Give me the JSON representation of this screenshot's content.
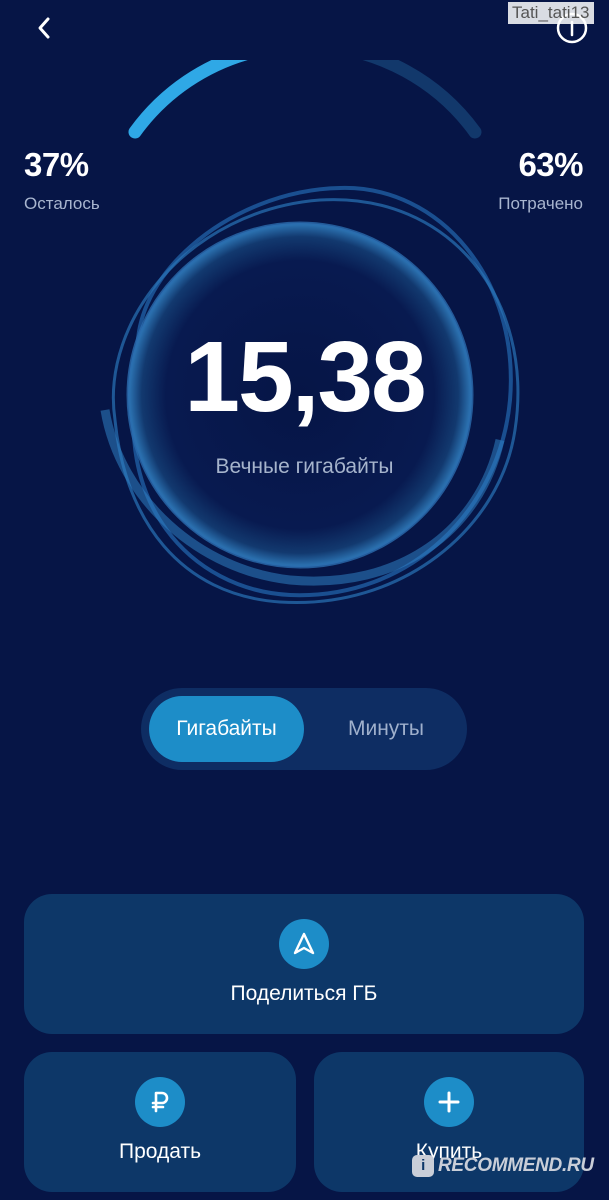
{
  "header": {
    "back_icon": "chevron-left-icon",
    "info_icon": "info-icon",
    "watermark_user": "Tati_tati13"
  },
  "usage": {
    "remaining_percent_label": "37%",
    "remaining_label": "Осталось",
    "spent_percent_label": "63%",
    "spent_label": "Потрачено",
    "remaining_fraction": 0.37
  },
  "balance": {
    "value": "15,38",
    "caption": "Вечные гигабайты"
  },
  "toggle": {
    "tabs": [
      {
        "label": "Гигабайты",
        "active": true
      },
      {
        "label": "Минуты",
        "active": false
      }
    ]
  },
  "actions": {
    "share": {
      "label": "Поделиться ГБ",
      "icon": "navigation-arrow-icon"
    },
    "sell": {
      "label": "Продать",
      "icon": "ruble-icon"
    },
    "buy": {
      "label": "Купить",
      "icon": "plus-icon"
    }
  },
  "watermark": {
    "text": "RECOMMEND.RU",
    "badge": "i"
  },
  "colors": {
    "background": "#061546",
    "accent": "#1d8dc8",
    "card": "#0d3768",
    "track": "#12386b"
  }
}
